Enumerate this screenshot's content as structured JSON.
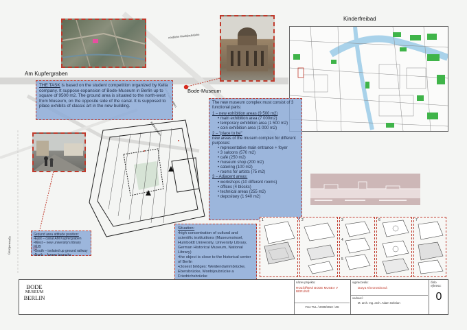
{
  "map_labels": {
    "kinderfreibad": "Kinderfreibad",
    "am_kupfergraben": "Am Kupfergraben",
    "bode_museum": "Bode-Museum",
    "monbijou": "nördliche Monbijoubrücke",
    "bodestr": "Am Kupfergraben",
    "canal": "Kupfergraben",
    "stadtbahn": "Georgenstraße"
  },
  "task_box": {
    "title": "THE TASK",
    "text": " is based on the student competition organized by Kella company. It suppose expansion of Bode-Museum in Berlin up to square of 9500 m2. The ground area is situated to the north-west from Museum, on the opposite side of the canal. It is supposed to place exhibits of classic art in the new building."
  },
  "complex_box": {
    "intro": "The new museum complex must consist of 3 functional parts:",
    "p1_title": "1 – new exhibition areas (9 500 m2)",
    "p1_items": [
      "main exhibition area (7 000m2)",
      "temporary exhibition area (1 500 m2)",
      "coin exhibition area (1 000 m2)"
    ],
    "p2_title": "2 – \"place to be\"",
    "p2_text": "new areas of the musem complex for different purposes:",
    "p2_items": [
      "representative main entrance + foyer",
      "3 saloons (570 m2)",
      "café (250 m2)",
      "museum shop (200 m2)",
      "catering (100 m2)",
      "rooms for artists (75 m2)"
    ],
    "p3_title": "3 – Adjacent areas:",
    "p3_items": [
      "workshops (10 different rooms)",
      "offices (4 blocks)",
      "technical areas (255 m2)",
      "depositary (1 940 m2)"
    ]
  },
  "attitude_box": {
    "title": "Ground area attitude position:",
    "items": [
      "East – canal AM Kupfergraben",
      "West – new university's library HUB",
      "South – isolated up ground  railway",
      "North – former barracks"
    ]
  },
  "situation_box": {
    "title": "Situation:",
    "items": [
      "high concentration of cultural and scientific instituttions (Museumsinsel, Humboldt University, University Library, German Historical Museum, National Library)",
      "the object is close to the historical center of Berlin",
      "closest bridges: Weidendammbrücke, Ebersbrücke, Monbijoubrücke a Friedrichsbrücke"
    ]
  },
  "axo_numbers": [
    "1",
    "2",
    "3",
    "4",
    "5",
    "6",
    "7"
  ],
  "title_block": {
    "logo_line1": "BODE",
    "logo_line2": "MUSEUM",
    "logo_line3": "BERLIN",
    "project_label": "název projektu:",
    "project_value": "ROZŠÍŘENÍ BODE MUSEA V BERLÍNĚ",
    "school_value": "FUA TUL / 2009/2010 / ZS",
    "author_label": "vypracovala:",
    "author_value": "Darya Khvorostinová",
    "leader_label": "vedoucí:",
    "leader_value": "M. arch. Ing. arch. Adam Gebrian",
    "sheet_label": "číslo výkresu:",
    "sheet_value": "0"
  },
  "colors": {
    "box_fill": "#8caad7",
    "dashed_red": "#c0392b",
    "map_green": "#3fb449",
    "water": "#a9d2ea"
  }
}
